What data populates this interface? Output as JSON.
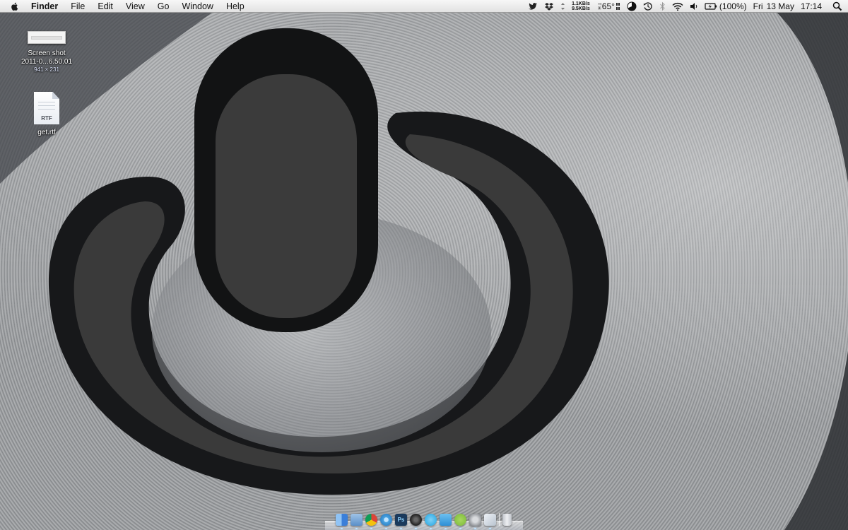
{
  "menubar": {
    "app_name": "Finder",
    "menus": [
      "File",
      "Edit",
      "View",
      "Go",
      "Window",
      "Help"
    ],
    "status": {
      "net_up": "1.1KB/s",
      "net_down": "9.5KB/s",
      "temp_prefix": "T\nH",
      "temp": "65°",
      "battery": "(100%)",
      "day": "Fri",
      "date": "13 May",
      "time": "17:14"
    }
  },
  "desktop": {
    "items": [
      {
        "label_line1": "Screen shot",
        "label_line2": "2011-0...6.50.01",
        "dimensions": "941 × 231",
        "icon": "screenshot-icon"
      },
      {
        "label_line1": "get.rtf",
        "icon": "rtf-document-icon",
        "badge": "RTF"
      }
    ]
  },
  "dock": {
    "items": [
      {
        "name": "finder",
        "color": "#3b7fd9"
      },
      {
        "name": "preview",
        "color": "#5b8fc9"
      },
      {
        "name": "chrome",
        "color": "#e9c33c"
      },
      {
        "name": "itunes",
        "color": "#4aa3e0"
      },
      {
        "name": "photoshop",
        "color": "#1b3a5c"
      },
      {
        "name": "aperture",
        "color": "#2a2a2a"
      },
      {
        "name": "skype",
        "color": "#21a4e0"
      },
      {
        "name": "twitter",
        "color": "#2e8fd6"
      },
      {
        "name": "spotify",
        "color": "#7ab83a"
      },
      {
        "name": "system-preferences",
        "color": "#8c8f94"
      },
      {
        "name": "mail",
        "color": "#b9c3cf"
      },
      {
        "name": "trash",
        "color": "#d9dce1"
      }
    ]
  }
}
